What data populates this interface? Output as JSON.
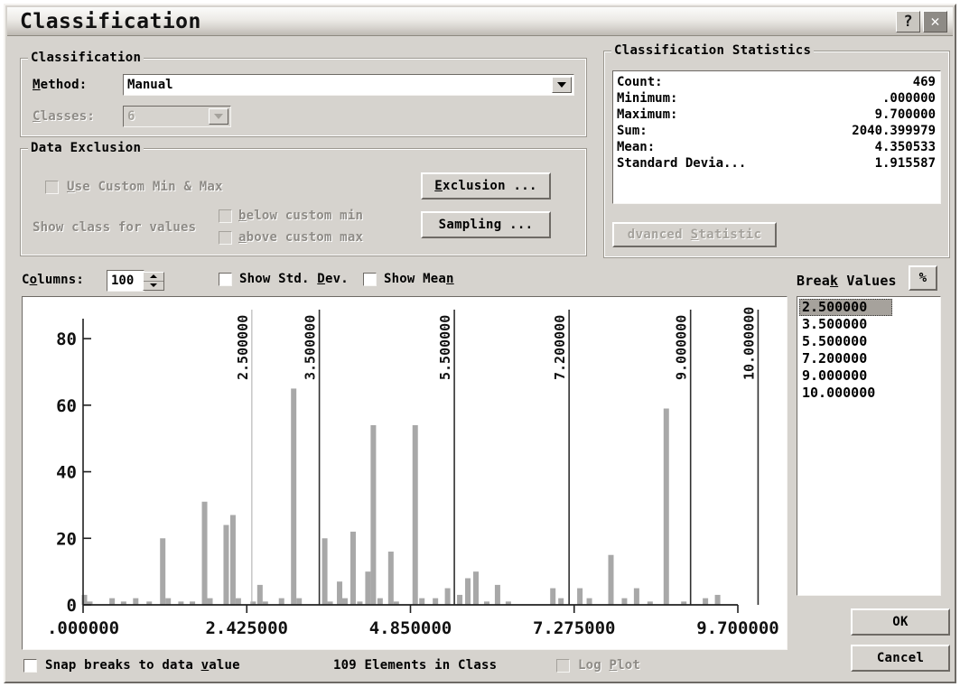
{
  "window": {
    "title": "Classification",
    "help_label": "?",
    "close_label": "✕"
  },
  "classification": {
    "group_title": "Classification",
    "method_label": "Method:",
    "method_value": "Manual",
    "classes_label": "Classes:",
    "classes_value": "6",
    "classes_enabled": false
  },
  "data_exclusion": {
    "group_title": "Data Exclusion",
    "use_custom_minmax_label": "Use Custom Min & Max",
    "use_custom_minmax_checked": false,
    "show_class_label": "Show class for values",
    "below_custom_min_label": "below custom min",
    "below_custom_min_checked": false,
    "above_custom_max_label": "above custom max",
    "above_custom_max_checked": false,
    "exclusion_button": "Exclusion ...",
    "sampling_button": "Sampling ..."
  },
  "statistics": {
    "group_title": "Classification Statistics",
    "rows": [
      {
        "label": "Count:",
        "value": "469"
      },
      {
        "label": "Minimum:",
        "value": ".000000"
      },
      {
        "label": "Maximum:",
        "value": "9.700000"
      },
      {
        "label": "Sum:",
        "value": "2040.399979"
      },
      {
        "label": "Mean:",
        "value": "4.350533"
      },
      {
        "label": "Standard Devia...",
        "value": "1.915587"
      }
    ],
    "advanced_button": "Advanced Statistics",
    "advanced_enabled": false
  },
  "columns": {
    "label": "Columns:",
    "value": "100",
    "spin_up": "▲",
    "spin_down": "▼"
  },
  "chart_options": {
    "show_std_dev_label": "Show Std. Dev.",
    "show_std_dev_checked": false,
    "show_mean_label": "Show Mean",
    "show_mean_checked": false
  },
  "break_values": {
    "header": "Break Values",
    "percent_button": "%",
    "items": [
      "2.500000",
      "3.500000",
      "5.500000",
      "7.200000",
      "9.000000",
      "10.000000"
    ],
    "selected_index": 0
  },
  "footer": {
    "snap_label": "Snap breaks to data value",
    "snap_checked": false,
    "elements_in_class": "109 Elements in Class",
    "log_plot_label": "Log Plot",
    "log_plot_checked": false,
    "log_plot_enabled": false,
    "ok_button": "OK",
    "cancel_button": "Cancel"
  },
  "colors": {
    "dialog_face": "#d6d3ce",
    "bar_fill": "#a8a8a8",
    "selection": "#a6a29c",
    "break_line": "#303030",
    "break_line_active": "#b9b9b9"
  },
  "chart_data": {
    "type": "bar",
    "title": "",
    "xlabel": "",
    "ylabel": "",
    "xlim": [
      0.0,
      9.7
    ],
    "ylim": [
      0,
      86
    ],
    "grid": false,
    "legend": false,
    "y_ticks": [
      0,
      20,
      40,
      60,
      80
    ],
    "y_tick_labels": [
      "0",
      "20",
      "40",
      "60",
      "80"
    ],
    "x_ticks": [
      0.0,
      2.425,
      4.85,
      7.275,
      9.7
    ],
    "x_tick_labels": [
      ".000000",
      "2.425000",
      "4.850000",
      "7.275000",
      "9.700000"
    ],
    "n_columns": 100,
    "break_lines": [
      {
        "value": 2.5,
        "label": "2.500000",
        "active": true
      },
      {
        "value": 3.5,
        "label": "3.500000",
        "active": false
      },
      {
        "value": 5.5,
        "label": "5.500000",
        "active": false
      },
      {
        "value": 7.2,
        "label": "7.200000",
        "active": false
      },
      {
        "value": 9.0,
        "label": "9.000000",
        "active": false
      },
      {
        "value": 10.0,
        "label": "10.000000",
        "active": false
      }
    ],
    "bars": [
      {
        "x": 0.02,
        "y": 3
      },
      {
        "x": 0.1,
        "y": 1
      },
      {
        "x": 0.43,
        "y": 2
      },
      {
        "x": 0.6,
        "y": 1
      },
      {
        "x": 0.78,
        "y": 2
      },
      {
        "x": 0.98,
        "y": 1
      },
      {
        "x": 1.18,
        "y": 20
      },
      {
        "x": 1.26,
        "y": 2
      },
      {
        "x": 1.45,
        "y": 1
      },
      {
        "x": 1.62,
        "y": 1
      },
      {
        "x": 1.8,
        "y": 31
      },
      {
        "x": 1.88,
        "y": 2
      },
      {
        "x": 2.12,
        "y": 24
      },
      {
        "x": 2.22,
        "y": 27
      },
      {
        "x": 2.3,
        "y": 2
      },
      {
        "x": 2.52,
        "y": 1
      },
      {
        "x": 2.62,
        "y": 6
      },
      {
        "x": 2.7,
        "y": 1
      },
      {
        "x": 2.94,
        "y": 2
      },
      {
        "x": 3.12,
        "y": 65
      },
      {
        "x": 3.2,
        "y": 2
      },
      {
        "x": 3.58,
        "y": 20
      },
      {
        "x": 3.66,
        "y": 1
      },
      {
        "x": 3.8,
        "y": 7
      },
      {
        "x": 3.88,
        "y": 2
      },
      {
        "x": 4.0,
        "y": 22
      },
      {
        "x": 4.1,
        "y": 1
      },
      {
        "x": 4.22,
        "y": 10
      },
      {
        "x": 4.3,
        "y": 54
      },
      {
        "x": 4.4,
        "y": 2
      },
      {
        "x": 4.56,
        "y": 16
      },
      {
        "x": 4.64,
        "y": 1
      },
      {
        "x": 4.92,
        "y": 54
      },
      {
        "x": 5.02,
        "y": 2
      },
      {
        "x": 5.22,
        "y": 2
      },
      {
        "x": 5.4,
        "y": 5
      },
      {
        "x": 5.58,
        "y": 3
      },
      {
        "x": 5.7,
        "y": 8
      },
      {
        "x": 5.82,
        "y": 10
      },
      {
        "x": 5.98,
        "y": 1
      },
      {
        "x": 6.14,
        "y": 6
      },
      {
        "x": 6.3,
        "y": 1
      },
      {
        "x": 6.96,
        "y": 5
      },
      {
        "x": 7.08,
        "y": 2
      },
      {
        "x": 7.36,
        "y": 5
      },
      {
        "x": 7.5,
        "y": 2
      },
      {
        "x": 7.82,
        "y": 15
      },
      {
        "x": 8.02,
        "y": 2
      },
      {
        "x": 8.2,
        "y": 5
      },
      {
        "x": 8.4,
        "y": 1
      },
      {
        "x": 8.64,
        "y": 59
      },
      {
        "x": 8.9,
        "y": 1
      },
      {
        "x": 9.22,
        "y": 2
      },
      {
        "x": 9.4,
        "y": 3
      }
    ]
  }
}
